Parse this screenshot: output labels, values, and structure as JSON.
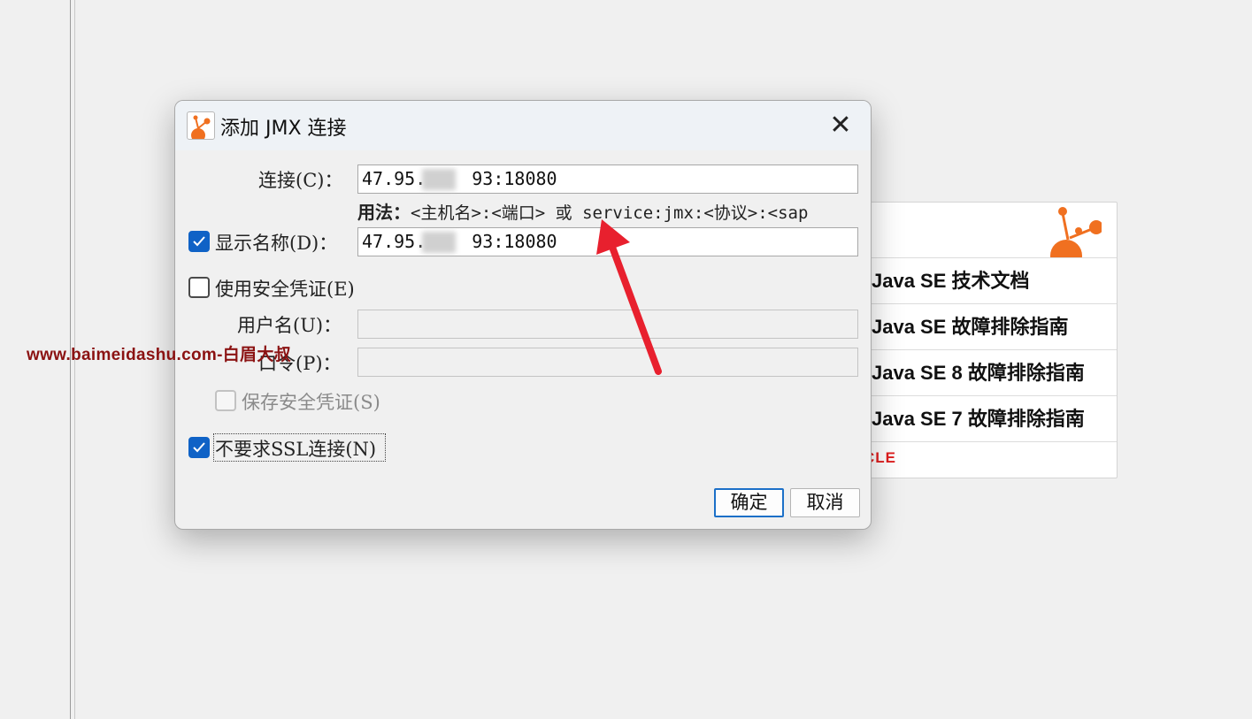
{
  "dialog": {
    "title": "添加 JMX 连接",
    "close_label": "✕",
    "connection": {
      "label": "连接(C)：",
      "value_prefix": "47.95.",
      "value_suffix": "93:18080"
    },
    "usage": {
      "label": "用法：",
      "text": "<主机名>:<端口> 或 service:jmx:<协议>:<sap"
    },
    "display_name": {
      "label": "显示名称(D)：",
      "checked": true,
      "value_prefix": "47.95.",
      "value_suffix": "93:18080"
    },
    "use_credentials": {
      "label": "使用安全凭证(E)",
      "checked": false
    },
    "username": {
      "label": "用户名(U)：",
      "value": ""
    },
    "password": {
      "label": "口令(P)：",
      "value": ""
    },
    "save_credentials": {
      "label": "保存安全凭证(S)",
      "checked": false,
      "enabled": false
    },
    "no_ssl": {
      "label": "不要求SSL连接(N)",
      "checked": true
    },
    "ok_label": "确定",
    "cancel_label": "取消"
  },
  "background_panel": {
    "items": [
      "Java SE 技术文档",
      "Java SE 故障排除指南",
      "Java SE 8 故障排除指南",
      "Java SE 7 故障排除指南"
    ],
    "footer_logo_text": "CLE"
  },
  "watermark": "www.baimeidashu.com-白眉大叔",
  "colors": {
    "accent_blue": "#0f62c6",
    "arrow_red": "#e8202e",
    "icon_orange": "#f07020",
    "watermark": "#8b1212"
  }
}
